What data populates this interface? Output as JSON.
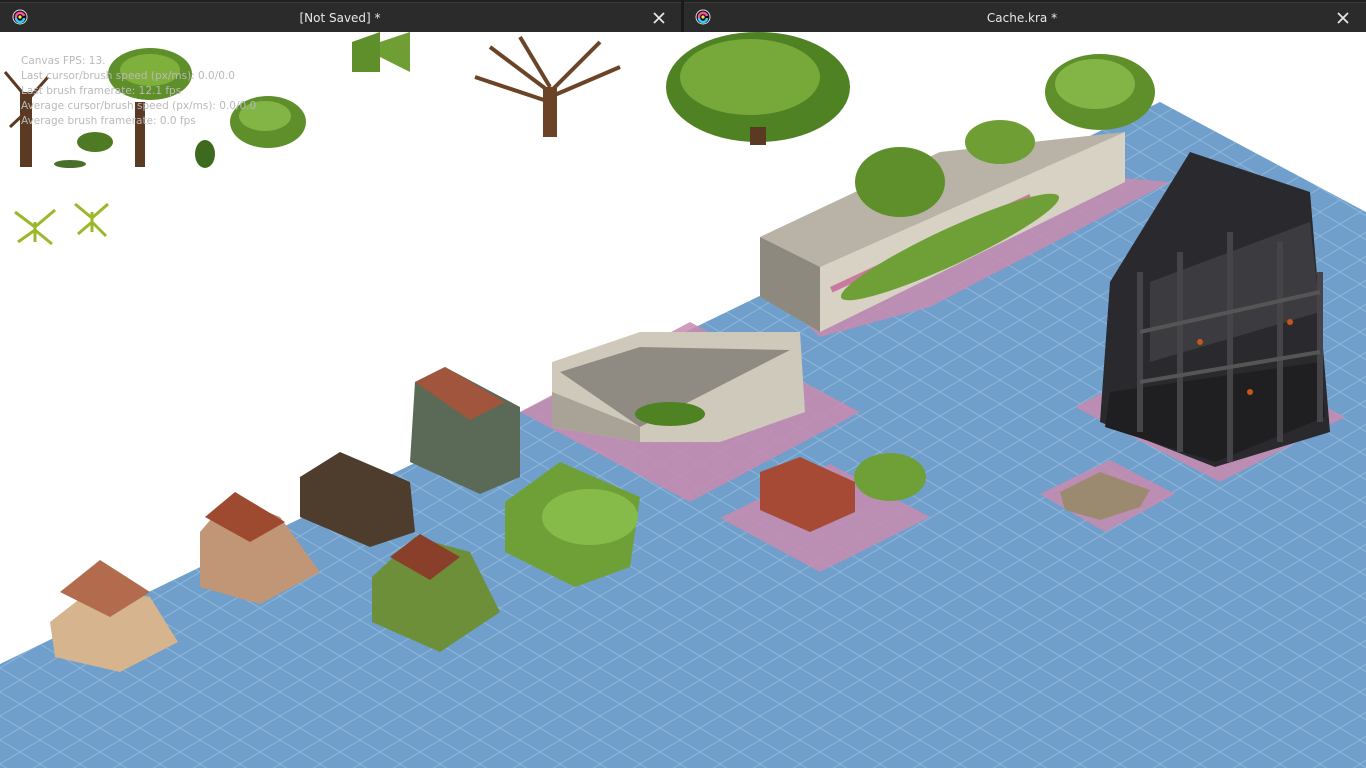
{
  "tabs": [
    {
      "title": "[Not Saved]  *",
      "logo": "krita-logo-icon",
      "close": "close-icon",
      "active": false
    },
    {
      "title": "Cache.kra *",
      "logo": "krita-logo-icon",
      "close": "close-icon",
      "active": true
    }
  ],
  "canvas": {
    "background": "#ffffff",
    "grid_fill": "#6f9fca",
    "grid_line": "#8fb6da",
    "tile_highlight": "#c98bb0"
  },
  "overlay_stats": {
    "canvas_fps": "Canvas FPS: 13.",
    "last_speed": "Last cursor/brush speed (px/ms): 0.0/0.0",
    "last_framerate": "Last brush framerate: 12.1 fps",
    "avg_speed": "Average cursor/brush speed (px/ms): 0.0/0.0",
    "avg_framerate": "Average brush framerate: 0.0 fps"
  }
}
